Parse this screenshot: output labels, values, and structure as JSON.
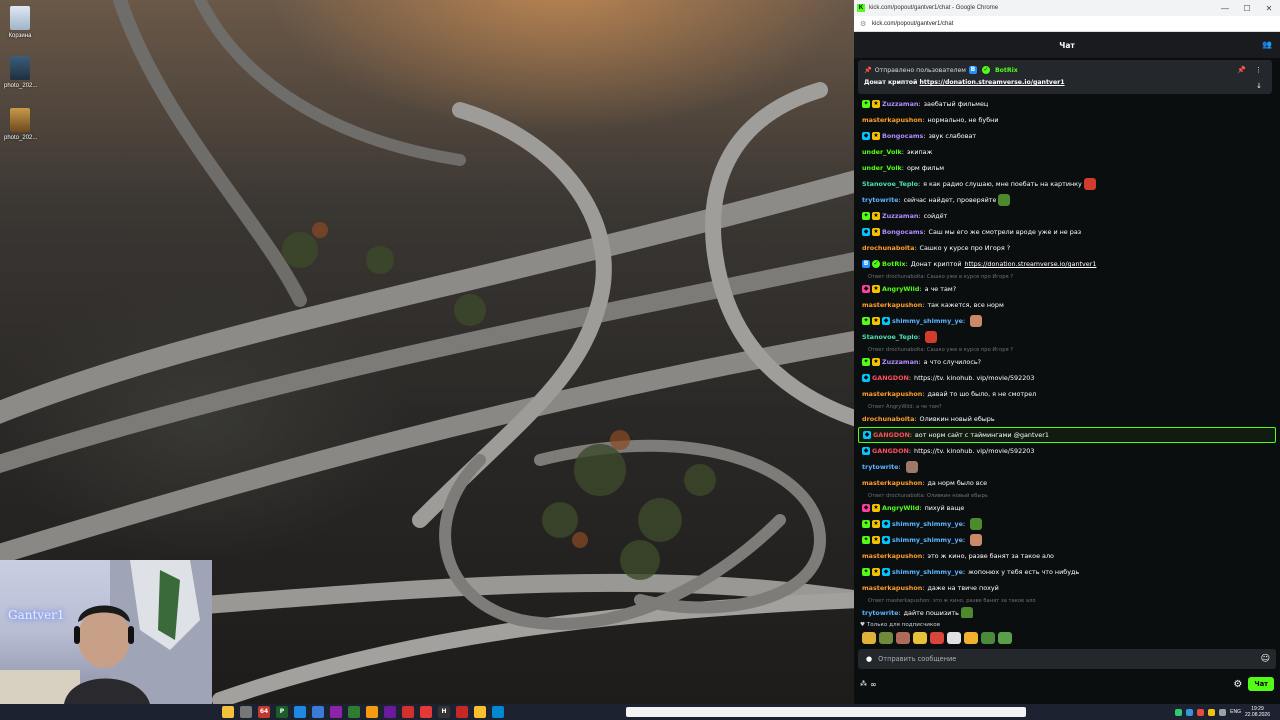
{
  "desktop": {
    "icons": [
      {
        "label": "Корзина",
        "icon": "recycle-bin-icon"
      },
      {
        "label": "photo_202...",
        "icon": "image-file-icon"
      },
      {
        "label": "photo_202...",
        "icon": "image-file-icon"
      }
    ]
  },
  "webcam": {
    "neon_sign": "Gantver1"
  },
  "browser": {
    "title": "kick.com/popout/gantver1/chat - Google Chrome",
    "url": "kick.com/popout/gantver1/chat",
    "window_buttons": [
      "—",
      "☐",
      "✕"
    ]
  },
  "chat": {
    "header_title": "Чат",
    "pinned": {
      "prefix": "Отправлено пользователем",
      "user": "BotRix",
      "text": "Донат криптой",
      "link": "https://donation.streamverse.io/gantver1"
    },
    "messages": [
      {
        "badges": [
          "vip",
          "sub"
        ],
        "user": "Zuzzaman",
        "color": "#b18cff",
        "text": "заебатый фильмец"
      },
      {
        "badges": [],
        "user": "masterkapushon",
        "color": "#ff9d2b",
        "text": "нормально, не бубни"
      },
      {
        "badges": [
          "gift",
          "sub"
        ],
        "user": "Bongocams",
        "color": "#b18cff",
        "text": "звук слабоват"
      },
      {
        "badges": [],
        "user": "under_Volk",
        "color": "#53fc18",
        "text": "экипаж"
      },
      {
        "badges": [],
        "user": "under_Volk",
        "color": "#53fc18",
        "text": "орм фильм"
      },
      {
        "badges": [],
        "user": "Stanovoe_Teplo",
        "color": "#4de0b8",
        "text": "я как радио слушаю, мне поебать на картинку",
        "emote": "#d33b2f"
      },
      {
        "badges": [],
        "user": "trytowrite",
        "color": "#5ab3ff",
        "text": "сейчас найдет, проверяйте",
        "emote": "#4c8a2d"
      },
      {
        "badges": [
          "vip",
          "sub"
        ],
        "user": "Zuzzaman",
        "color": "#b18cff",
        "text": "сойдёт"
      },
      {
        "badges": [
          "gift",
          "sub"
        ],
        "user": "Bongocams",
        "color": "#b18cff",
        "text": "Саш мы его же смотрели вроде уже и не раз"
      },
      {
        "badges": [],
        "user": "drochunabolta",
        "color": "#ff9d2b",
        "text": "Сашко у курсе про Игоря ?"
      },
      {
        "badges": [
          "bot",
          "ver"
        ],
        "user": "BotRix",
        "color": "#53fc18",
        "text": "Донат криптой",
        "link": "https://donation.streamverse.io/gantver1"
      },
      {
        "reply": "Ответ drochunabolta: Сашко уже в курсе про Игоря ?"
      },
      {
        "badges": [
          "og",
          "sub"
        ],
        "user": "AngryWild",
        "color": "#53fc18",
        "text": "а че там?"
      },
      {
        "badges": [],
        "user": "masterkapushon",
        "color": "#ff9d2b",
        "text": "так кажется, все норм"
      },
      {
        "badges": [
          "vip",
          "sub",
          "gift"
        ],
        "user": "shimmy_shimmy_ye",
        "color": "#5ab3ff",
        "text": "",
        "emote": "#c98a6a"
      },
      {
        "badges": [],
        "user": "Stanovoe_Teplo",
        "color": "#4de0b8",
        "text": "",
        "emote": "#d33b2f"
      },
      {
        "reply": "Ответ drochunabolta: Сашко уже в курсе про Игоря ?"
      },
      {
        "badges": [
          "vip",
          "sub"
        ],
        "user": "Zuzzaman",
        "color": "#b18cff",
        "text": "а что случилось?"
      },
      {
        "badges": [
          "gift"
        ],
        "user": "GANGDON",
        "color": "#ff4d5e",
        "text": "https://tv. kinohub. vip/movie/592203"
      },
      {
        "badges": [],
        "user": "masterkapushon",
        "color": "#ff9d2b",
        "text": "давай то шо было, я не смотрел"
      },
      {
        "reply": "Ответ AngryWild: а че там?"
      },
      {
        "badges": [],
        "user": "drochunabolta",
        "color": "#ff9d2b",
        "text": "Оливкин новый ебырь"
      },
      {
        "badges": [
          "gift"
        ],
        "user": "GANGDON",
        "color": "#ff4d5e",
        "text": "вот норм сайт с таймингами @gantver1",
        "highlight": true
      },
      {
        "badges": [
          "gift"
        ],
        "user": "GANGDON",
        "color": "#ff4d5e",
        "text": "https://tv. kinohub. vip/movie/592203"
      },
      {
        "badges": [],
        "user": "trytowrite",
        "color": "#5ab3ff",
        "text": "",
        "emote": "#a0786a"
      },
      {
        "badges": [],
        "user": "masterkapushon",
        "color": "#ff9d2b",
        "text": "да норм было все"
      },
      {
        "reply": "Ответ drochunabolta: Оливкин новый ебырь"
      },
      {
        "badges": [
          "og",
          "sub"
        ],
        "user": "AngryWild",
        "color": "#53fc18",
        "text": "пихуй ваще"
      },
      {
        "badges": [
          "vip",
          "sub",
          "gift"
        ],
        "user": "shimmy_shimmy_ye",
        "color": "#5ab3ff",
        "text": "",
        "emote": "#4c8a2d"
      },
      {
        "badges": [
          "vip",
          "sub",
          "gift"
        ],
        "user": "shimmy_shimmy_ye",
        "color": "#5ab3ff",
        "text": "",
        "emote": "#c98a6a"
      },
      {
        "badges": [],
        "user": "masterkapushon",
        "color": "#ff9d2b",
        "text": "это ж кино, разве банят за такое ало"
      },
      {
        "badges": [
          "vip",
          "sub",
          "gift"
        ],
        "user": "shimmy_shimmy_ye",
        "color": "#5ab3ff",
        "text": "жопонюх у тебя есть что нибудь"
      },
      {
        "badges": [],
        "user": "masterkapushon",
        "color": "#ff9d2b",
        "text": "даже на твиче похуй"
      },
      {
        "reply": "Ответ masterkapushon: это ж кино, разве банят за такое ало"
      },
      {
        "badges": [],
        "user": "trytowrite",
        "color": "#5ab3ff",
        "text": "дайте пошизить",
        "emote": "#4c8a2d"
      }
    ],
    "subs_only_label": "Только для подписчиков",
    "emote_colors": [
      "#e0b23a",
      "#6f8a3a",
      "#b06a5a",
      "#e8c23a",
      "#d8453a",
      "#e0e0e0",
      "#f0b030",
      "#4a8a3a",
      "#5aa04a"
    ],
    "input_placeholder": "Отправить сообщение",
    "bottom_left": "∞",
    "send_button": "Чат"
  },
  "taskbar": {
    "icons": [
      {
        "name": "file-explorer-icon",
        "color": "#f3c23a",
        "glyph": ""
      },
      {
        "name": "app-icon-2",
        "color": "#777777",
        "glyph": ""
      },
      {
        "name": "app-64-icon",
        "color": "#c0392b",
        "glyph": "64"
      },
      {
        "name": "terminal-icon",
        "color": "#1a5e2a",
        "glyph": "P"
      },
      {
        "name": "edge-icon",
        "color": "#1e88e5",
        "glyph": ""
      },
      {
        "name": "calculator-icon",
        "color": "#3a7bd5",
        "glyph": ""
      },
      {
        "name": "app-icon-7",
        "color": "#8e24aa",
        "glyph": ""
      },
      {
        "name": "app-icon-8",
        "color": "#2e7d32",
        "glyph": ""
      },
      {
        "name": "app-icon-9",
        "color": "#f39c12",
        "glyph": ""
      },
      {
        "name": "app-icon-10",
        "color": "#6a1b9a",
        "glyph": ""
      },
      {
        "name": "app-icon-11",
        "color": "#d32f2f",
        "glyph": ""
      },
      {
        "name": "chrome-icon",
        "color": "#e53935",
        "glyph": ""
      },
      {
        "name": "app-h-icon",
        "color": "#333333",
        "glyph": "H"
      },
      {
        "name": "app-icon-14",
        "color": "#c62828",
        "glyph": ""
      },
      {
        "name": "chrome-icon-2",
        "color": "#fbc02d",
        "glyph": ""
      },
      {
        "name": "app-icon-16",
        "color": "#0288d1",
        "glyph": ""
      }
    ],
    "lang": "ENG",
    "time": "19:29",
    "date": "22.08.2026"
  }
}
